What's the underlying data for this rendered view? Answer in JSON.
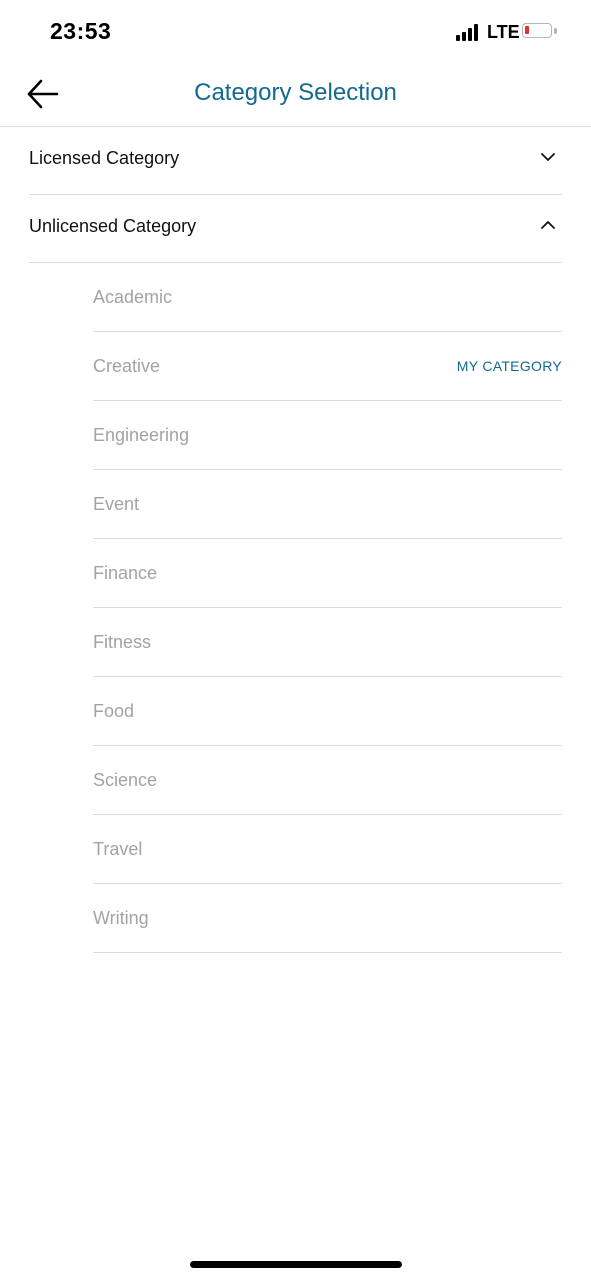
{
  "status_bar": {
    "time": "23:53",
    "network": "LTE",
    "signal_bars": 4,
    "battery_color": "#e0332e"
  },
  "header": {
    "title": "Category Selection",
    "back_icon": "arrow-left-icon"
  },
  "sections": [
    {
      "label": "Licensed Category",
      "expanded": false
    },
    {
      "label": "Unlicensed Category",
      "expanded": true
    }
  ],
  "categories": [
    {
      "label": "Academic",
      "badge": ""
    },
    {
      "label": "Creative",
      "badge": "MY CATEGORY"
    },
    {
      "label": "Engineering",
      "badge": ""
    },
    {
      "label": "Event",
      "badge": ""
    },
    {
      "label": "Finance",
      "badge": ""
    },
    {
      "label": "Fitness",
      "badge": ""
    },
    {
      "label": "Food",
      "badge": ""
    },
    {
      "label": "Science",
      "badge": ""
    },
    {
      "label": "Travel",
      "badge": ""
    },
    {
      "label": "Writing",
      "badge": ""
    }
  ],
  "colors": {
    "accent": "#13698f",
    "muted_text": "#a3a3a3",
    "divider": "#dcdcdc"
  }
}
